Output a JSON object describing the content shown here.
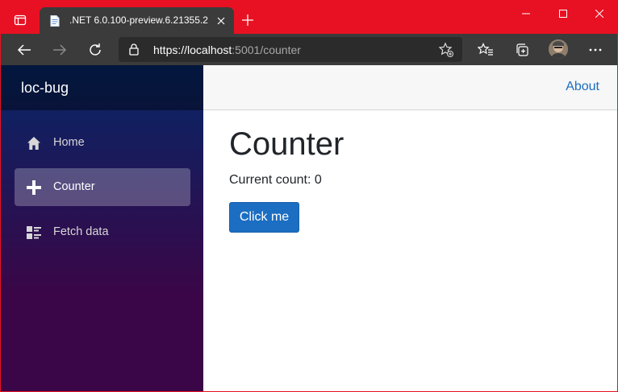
{
  "browser": {
    "tab": {
      "title": ".NET 6.0.100-preview.6.21355.2",
      "favicon": "document-icon"
    },
    "url": {
      "scheme_host": "https://localhost",
      "rest": ":5001/counter"
    },
    "window_controls": [
      "minimize-icon",
      "maximize-icon",
      "close-icon"
    ],
    "toolbar_icons": [
      "back-arrow-icon",
      "forward-arrow-icon",
      "refresh-icon",
      "lock-icon",
      "add-favorite-icon",
      "favorites-icon",
      "collections-icon",
      "profile-avatar",
      "more-icon"
    ],
    "accent_color": "#e81123"
  },
  "app": {
    "brand": "loc-bug",
    "nav": [
      {
        "label": "Home",
        "icon": "home-icon",
        "active": false
      },
      {
        "label": "Counter",
        "icon": "plus-icon",
        "active": true
      },
      {
        "label": "Fetch data",
        "icon": "list-rich-icon",
        "active": false
      }
    ],
    "top_link": "About",
    "page": {
      "title": "Counter",
      "count_label": "Current count: 0",
      "button_label": "Click me"
    },
    "colors": {
      "link": "#1b6ec2",
      "button": "#1b6ec2",
      "sidebar_top": "#052767",
      "sidebar_bottom": "#3a0647"
    }
  }
}
